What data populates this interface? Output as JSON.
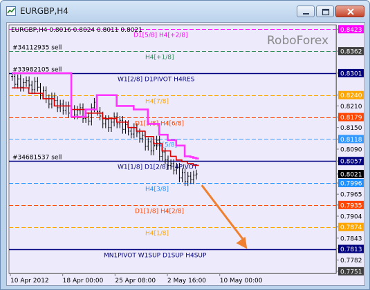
{
  "window": {
    "title": "EURGBP,H4"
  },
  "chart_data": {
    "type": "line",
    "symbol_info": "EURGBP,H4  0.8016 0.8024 0.8011 0.8021",
    "watermark": "RoboForex",
    "ylim": [
      0.7745,
      0.8435
    ],
    "price_ticks": [
      "0.8423",
      "0.8362",
      "0.8301",
      "0.8240",
      "0.8210",
      "0.8179",
      "0.8150",
      "0.8118",
      "0.8090",
      "0.8057",
      "0.8021",
      "0.7996",
      "0.7965",
      "0.7935",
      "0.7904",
      "0.7874",
      "0.7843",
      "0.7813",
      "0.7782",
      "0.7751"
    ],
    "price_tick_values": [
      0.8423,
      0.8362,
      0.8301,
      0.824,
      0.821,
      0.8179,
      0.815,
      0.8118,
      0.809,
      0.8057,
      0.8021,
      0.7996,
      0.7965,
      0.7935,
      0.7904,
      0.7874,
      0.7843,
      0.7813,
      0.7782,
      0.7751
    ],
    "highlighted_ticks": [
      {
        "label": "0.8423",
        "color": "#ff00ff"
      },
      {
        "label": "0.8362",
        "color": "#404040"
      },
      {
        "label": "0.8301",
        "color": "#000080"
      },
      {
        "label": "0.8240",
        "color": "#ffa500"
      },
      {
        "label": "0.8179",
        "color": "#ff4500"
      },
      {
        "label": "0.8118",
        "color": "#3399ff"
      },
      {
        "label": "0.8057",
        "color": "#000080"
      },
      {
        "label": "0.8021",
        "color": "#000000"
      },
      {
        "label": "0.7996",
        "color": "#1e90ff"
      },
      {
        "label": "0.7935",
        "color": "#ff4500"
      },
      {
        "label": "0.7874",
        "color": "#ffa500"
      },
      {
        "label": "0.7813",
        "color": "#000080"
      },
      {
        "label": "0.7751",
        "color": "#404040"
      }
    ],
    "date_ticks": [
      "10 Apr 2012",
      "18 Apr 00:00",
      "25 Apr 08:00",
      "2 May 16:00",
      "10 May 00:00"
    ],
    "date_tick_positions": [
      0.0,
      0.16,
      0.32,
      0.48,
      0.64
    ],
    "levels": [
      {
        "label": "D1[5/8] H4[+2/8]",
        "value": 0.8423,
        "color": "#ff00ff",
        "style": "dash"
      },
      {
        "label": "H4[+1/8]",
        "value": 0.8362,
        "color": "#2e8b57",
        "style": "dash"
      },
      {
        "label": "#34112935 sell",
        "value": 0.8362,
        "color": "#2e8b57",
        "style": "dash"
      },
      {
        "label": "W1[2/8] D1PIVOT H4RES",
        "value": 0.8301,
        "color": "#000080",
        "style": "solid"
      },
      {
        "label": "#33982105 sell",
        "value": 0.8301,
        "color": "#000080",
        "style": "solid"
      },
      {
        "label": "H4[7/8]",
        "value": 0.824,
        "color": "#ffa500",
        "style": "dash"
      },
      {
        "label": "D1[3/8] H4[6/8]",
        "value": 0.8179,
        "color": "#ff4500",
        "style": "dash"
      },
      {
        "label": "H4[5/8]",
        "value": 0.8118,
        "color": "#3399ff",
        "style": "dash"
      },
      {
        "label": "W1[1/8] D1[2/8] H4PIVOT",
        "value": 0.8057,
        "color": "#000080",
        "style": "solid"
      },
      {
        "label": "#34681537 sell",
        "value": 0.8057,
        "color": "#000080",
        "style": "solid"
      },
      {
        "label": "H4[3/8]",
        "value": 0.7996,
        "color": "#1e90ff",
        "style": "dash"
      },
      {
        "label": "D1[1/8] H4[2/8]",
        "value": 0.7935,
        "color": "#ff4500",
        "style": "dash"
      },
      {
        "label": "H4[1/8]",
        "value": 0.7874,
        "color": "#ffa500",
        "style": "dash"
      },
      {
        "label": "MN1PIVOT W1SUP D1SUP H4SUP",
        "value": 0.7813,
        "color": "#000080",
        "style": "solid"
      }
    ],
    "price_series": [
      0.8292,
      0.827,
      0.8285,
      0.8262,
      0.8275,
      0.828,
      0.8268,
      0.8255,
      0.8278,
      0.8262,
      0.824,
      0.8252,
      0.823,
      0.8215,
      0.8235,
      0.8225,
      0.8205,
      0.8215,
      0.8198,
      0.821,
      0.819,
      0.82,
      0.8185,
      0.8198,
      0.8205,
      0.8175,
      0.818,
      0.8168,
      0.8205,
      0.822,
      0.8195,
      0.8182,
      0.816,
      0.8172,
      0.815,
      0.8165,
      0.818,
      0.816,
      0.817,
      0.8145,
      0.8158,
      0.814,
      0.8132,
      0.815,
      0.8135,
      0.812,
      0.8128,
      0.8098,
      0.811,
      0.8085,
      0.81,
      0.8115,
      0.807,
      0.8082,
      0.806,
      0.8045,
      0.805,
      0.8032,
      0.804,
      0.801,
      0.8025,
      0.8,
      0.8015,
      0.8005,
      0.8018,
      0.8021
    ],
    "resistance_pink": [
      0.8301,
      0.8301,
      0.8301,
      0.8301,
      0.8301,
      0.8301,
      0.8301,
      0.8301,
      0.8301,
      0.8301,
      0.8301,
      0.8301,
      0.8301,
      0.8301,
      0.8301,
      0.8301,
      0.8301,
      0.8301,
      0.8301,
      0.8301,
      0.8301,
      0.818,
      0.818,
      0.818,
      0.818,
      0.818,
      0.82,
      0.82,
      0.82,
      0.82,
      0.824,
      0.824,
      0.824,
      0.824,
      0.824,
      0.824,
      0.824,
      0.821,
      0.821,
      0.821,
      0.821,
      0.821,
      0.821,
      0.82,
      0.82,
      0.82,
      0.82,
      0.82,
      0.816,
      0.816,
      0.816,
      0.816,
      0.813,
      0.813,
      0.813,
      0.8115,
      0.8115,
      0.8115,
      0.81,
      0.81,
      0.81,
      0.807,
      0.807,
      0.8068,
      0.8066,
      0.8064
    ],
    "resistance_red": [
      0.826,
      0.826,
      0.826,
      0.826,
      0.826,
      0.826,
      0.8245,
      0.8245,
      0.8245,
      0.8245,
      0.8245,
      0.823,
      0.823,
      0.823,
      0.823,
      0.821,
      0.821,
      0.821,
      0.821,
      0.821,
      0.821,
      0.82,
      0.82,
      0.82,
      0.82,
      0.82,
      0.819,
      0.819,
      0.819,
      0.819,
      0.819,
      0.819,
      0.8175,
      0.8175,
      0.8175,
      0.8175,
      0.8175,
      0.8165,
      0.8165,
      0.8165,
      0.8165,
      0.815,
      0.815,
      0.815,
      0.814,
      0.814,
      0.814,
      0.8125,
      0.8125,
      0.8125,
      0.8105,
      0.8105,
      0.8105,
      0.8085,
      0.8085,
      0.8085,
      0.807,
      0.807,
      0.806,
      0.806,
      0.8055,
      0.8055,
      0.805,
      0.805,
      0.8045,
      0.8045
    ],
    "forecast_arrow": {
      "from_index": 67,
      "from_value": 0.799,
      "to_index": 83,
      "to_value": 0.7813,
      "color": "#f08030"
    }
  }
}
